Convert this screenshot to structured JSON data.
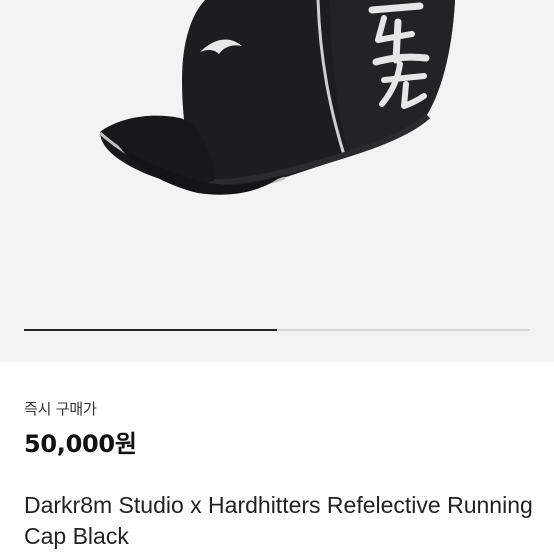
{
  "product": {
    "image_alt": "Black running cap with reflective piping, boomerang logo and white brush-stroke character",
    "gallery_progress": 0.5,
    "price_label": "즉시 구매가",
    "price": "50,000원",
    "title": "Darkr8m Studio x Hardhitters Refelective Running Cap Black"
  },
  "colors": {
    "cap": "#1d1d1f",
    "reflective": "#c9c9c9",
    "background": "#f3f3f3"
  }
}
